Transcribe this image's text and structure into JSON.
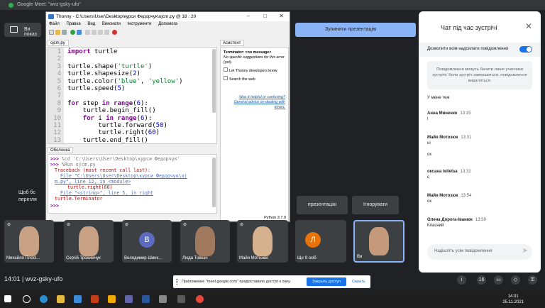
{
  "browser": {
    "tab_title": "Google Meet: \"wvz-gsky-ufo\""
  },
  "meet": {
    "present_left": "Ви показ",
    "present_right": "Зупинити презентацію",
    "side_text_1": "Щоб бс",
    "side_text_2": "перегля",
    "present_dark": "презентацію",
    "ignore": "Ігнорувати",
    "clock": "14:01",
    "separator": "|",
    "meeting_code": "wvz-gsky-ufo",
    "participants_count": "16",
    "tiles": [
      {
        "name": "Михайло Плосі..."
      },
      {
        "name": "Сергій Трохимчук"
      },
      {
        "name": "Володимир Шинк...",
        "initial": "В"
      },
      {
        "name": "Люда Товкач"
      },
      {
        "name": "Майя Мотозюк"
      },
      {
        "name": "Ще 9 осіб",
        "initial": "Л"
      },
      {
        "name": "Ви"
      }
    ]
  },
  "thonny": {
    "title": "Thonny - C:\\Users\\User\\Desktop\\курси Федорчук\\ojcm.py @ 18 : 20",
    "menu": [
      "Файл",
      "Правка",
      "Вид",
      "Виконати",
      "Інструменти",
      "Допомога"
    ],
    "editor_tab": "ojcm.py",
    "code": [
      {
        "n": "1",
        "t": "import turtle"
      },
      {
        "n": "2",
        "t": ""
      },
      {
        "n": "3",
        "t": "turtle.shape('turtle')"
      },
      {
        "n": "4",
        "t": "turtle.shapesize(2)"
      },
      {
        "n": "5",
        "t": "turtle.color('blue', 'yellow')"
      },
      {
        "n": "6",
        "t": "turtle.speed(5)"
      },
      {
        "n": "7",
        "t": ""
      },
      {
        "n": "8",
        "t": "for step in range(6):"
      },
      {
        "n": "9",
        "t": "    turtle.begin_fill()"
      },
      {
        "n": "10",
        "t": "    for i in range(6):"
      },
      {
        "n": "11",
        "t": "        turtle.forward(50)"
      },
      {
        "n": "12",
        "t": "        turtle.right(60)"
      },
      {
        "n": "13",
        "t": "    turtle.end_fill()"
      }
    ],
    "shell_tab": "Оболонка",
    "shell": {
      "l1": "%cd 'C:\\Users\\User\\Desktop\\курси Федорчук'",
      "l2": "%Run ojcm.py",
      "l3": "Traceback (most recent call last):",
      "l4a": "File \"C:\\Users\\User\\Desktop\\курси Федорчук\\oj",
      "l4b": "m.py\", line 12, in <module>",
      "l5": "turtle.right(60)",
      "l6": "File \"<string>\", line 5, in right",
      "l7": "turtle.Terminator",
      "prompt": ">>>"
    },
    "assistant_tab": "Асистент",
    "assistant": {
      "head": "Terminator: <no message>",
      "sub": "No specific suggestions for this error (yet).",
      "opt1": "Let Thonny developers know",
      "opt2": "Search the web",
      "link1": "Was it helpful or confusing?",
      "link2": "General advice on dealing with errors."
    },
    "status": "Python 3.7.9"
  },
  "chat": {
    "title": "Чат під час зустрічі",
    "toggle_label": "Дозволити всім надсилати повідомлення",
    "notice": "Повідомлення можуть бачити лише учасники зустрічі. Коли зустріч завершиться, повідомлення видаляться.",
    "messages": [
      {
        "author": "",
        "time": "",
        "text": "У мене теж"
      },
      {
        "author": "Анна Миненко",
        "time": "13:15",
        "text": "і"
      },
      {
        "author": "Майя Мотозюк",
        "time": "13:31",
        "text": "ні"
      },
      {
        "author": "",
        "time": "",
        "text": "ок"
      },
      {
        "author": "оксана telletsa",
        "time": "13:32",
        "text": "є"
      },
      {
        "author": "Майя Мотозюк",
        "time": "13:54",
        "text": "ок"
      },
      {
        "author": "Олена Дорога-Іванюк",
        "time": "13:59",
        "text": "Класний"
      }
    ],
    "input_placeholder": "Надішліть усім повідомлення"
  },
  "share_bar": {
    "message": "Приложение \"meet.google.com\" предоставило доступ к окну.",
    "stop": "Закрыть доступ",
    "hide": "Скрыть"
  },
  "taskbar": {
    "time": "14:01",
    "date": "25.11.2021"
  }
}
